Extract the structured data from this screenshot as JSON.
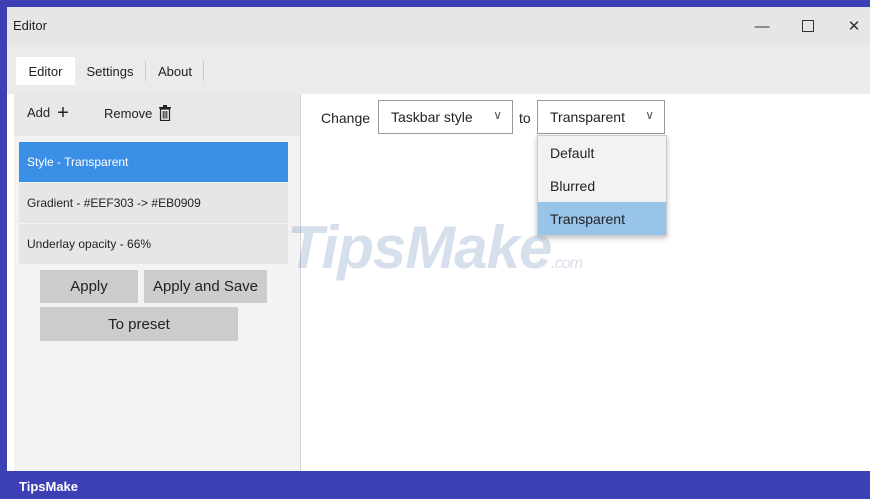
{
  "window": {
    "title": "Editor"
  },
  "tabs": [
    {
      "label": "Editor"
    },
    {
      "label": "Settings"
    },
    {
      "label": "About"
    }
  ],
  "sidebar": {
    "add_label": "Add",
    "remove_label": "Remove",
    "items": [
      {
        "label": "Style - Transparent"
      },
      {
        "label": "Gradient - #EEF303 -> #EB0909"
      },
      {
        "label": "Underlay opacity - 66%"
      }
    ],
    "apply_label": "Apply",
    "apply_save_label": "Apply and Save",
    "preset_label": "To preset"
  },
  "main": {
    "change_label": "Change",
    "target_select": "Taskbar style",
    "to_label": "to",
    "value_select": "Transparent",
    "options": [
      "Default",
      "Blurred",
      "Transparent"
    ]
  },
  "watermark": {
    "main": "TipsMake",
    "suffix": ".com"
  },
  "footer": {
    "brand": "TipsMake"
  },
  "colors": {
    "accent": "#3a8ee6",
    "selected_option": "#99c4ea",
    "footer_bg": "#3d3fb5"
  }
}
